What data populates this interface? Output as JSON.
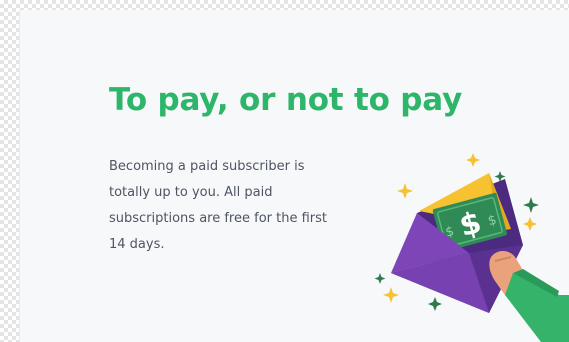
{
  "card": {
    "title": "To pay, or not to pay",
    "body": "Becoming a paid subscriber is totally up to you. All paid subscriptions are free for the first 14 days."
  },
  "illustration": {
    "icon": "envelope-money-icon",
    "bill_symbol": "$",
    "colors": {
      "accent_green": "#2db56a",
      "envelope_purple": "#6b3aa0",
      "envelope_dark": "#4b2a80",
      "bill_green": "#2f8a55",
      "sparkle_yellow": "#f6c231"
    }
  }
}
